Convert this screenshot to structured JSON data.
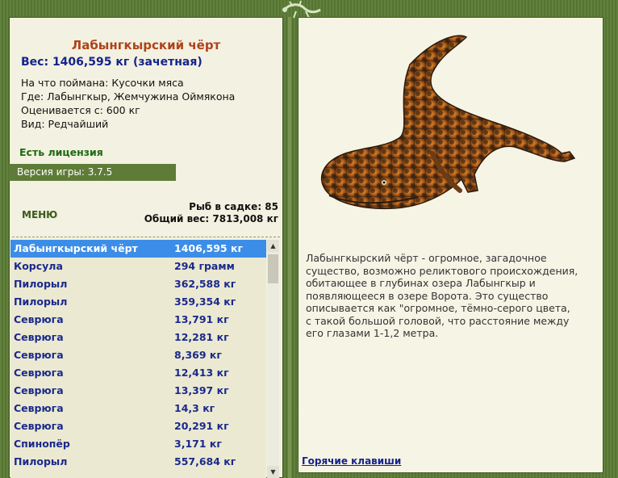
{
  "catch": {
    "title": "Лабынгкырский чёрт",
    "weight_line": "Вес: 1406,595 кг (зачетная)",
    "bait": "На что поймана: Кусочки мяса",
    "location": "Где: Лабынгкыр, Жемчужина Оймякона",
    "value": "Оценивается с: 600 кг",
    "kind": "Вид: Редчайший"
  },
  "license": "Есть лицензия",
  "version": "Версия игры: 3.7.5",
  "menu_label": "МЕНЮ",
  "stats": {
    "fish_count": "Рыб в садке: 85",
    "total_weight": "Общий вес: 7813,008 кг"
  },
  "fish_list": [
    {
      "name": "Лабынгкырский чёрт",
      "weight": "1406,595 кг",
      "selected": true
    },
    {
      "name": "Корсула",
      "weight": "294 грамм"
    },
    {
      "name": "Пилорыл",
      "weight": "362,588 кг"
    },
    {
      "name": "Пилорыл",
      "weight": "359,354 кг"
    },
    {
      "name": "Севрюга",
      "weight": "13,791 кг"
    },
    {
      "name": "Севрюга",
      "weight": "12,281 кг"
    },
    {
      "name": "Севрюга",
      "weight": "8,369 кг"
    },
    {
      "name": "Севрюга",
      "weight": "12,413 кг"
    },
    {
      "name": "Севрюга",
      "weight": "13,397 кг"
    },
    {
      "name": "Севрюга",
      "weight": "14,3 кг"
    },
    {
      "name": "Севрюга",
      "weight": "20,291 кг"
    },
    {
      "name": "Спинопёр",
      "weight": "3,171 кг"
    },
    {
      "name": "Пилорыл",
      "weight": "557,684 кг"
    }
  ],
  "description": "Лабынгкырский чёрт - огромное, загадочное существо, возможно реликтового происхождения, обитающее в глубинах озера Лабынгкыр и появляющееся в озере Ворота. Это существо описывается как \"огромное, тёмно-серого цвета, с такой большой головой, что расстояние между его глазами 1-1,2 метра.",
  "hotkeys_link": "Горячие клавиши",
  "colors": {
    "frame": "#5a7a34",
    "title": "#b0421a",
    "navy": "#14248a",
    "license": "#1e6a13",
    "selection": "#3c8de8"
  }
}
